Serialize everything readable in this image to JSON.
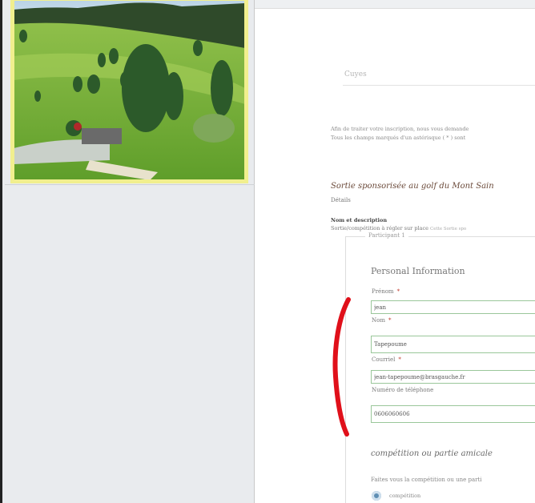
{
  "search": {
    "placeholder": "Cuyes"
  },
  "intro": {
    "line1": "Afin de traiter votre inscription, nous vous demande",
    "line2": "Tous les champs marqués d'un astérisque ( * ) sont"
  },
  "event": {
    "title": "Sortie sponsorisée au golf du Mont Sain",
    "details_link": "Détails"
  },
  "description": {
    "heading": "Nom et description",
    "text": "Sortie/compétition à régler sur place",
    "hint": "Cette Sortie spo"
  },
  "participant": {
    "legend": "Participant 1",
    "section_title": "Personal Information",
    "fields": {
      "first_name": {
        "label": "Prénom",
        "required": "*",
        "value": "jean"
      },
      "last_name": {
        "label": "Nom",
        "required": "*",
        "value": "Tapepoume"
      },
      "email": {
        "label": "Courriel",
        "required": "*",
        "value": "jean-tapepoume@brasgauche.fr"
      },
      "phone": {
        "label": "Numéro de téléphone",
        "value": "0606060606"
      }
    }
  },
  "competition": {
    "title": "compétition ou partie amicale",
    "question": "Faites vous la compétition ou une parti",
    "option_selected": "compétition"
  },
  "colors": {
    "left_bg": "#e9ebee",
    "photo_frame": "#f1ef8e",
    "input_border": "#9ac79a",
    "annotation_red": "#e0101a",
    "radio": "#5f8fb4"
  }
}
